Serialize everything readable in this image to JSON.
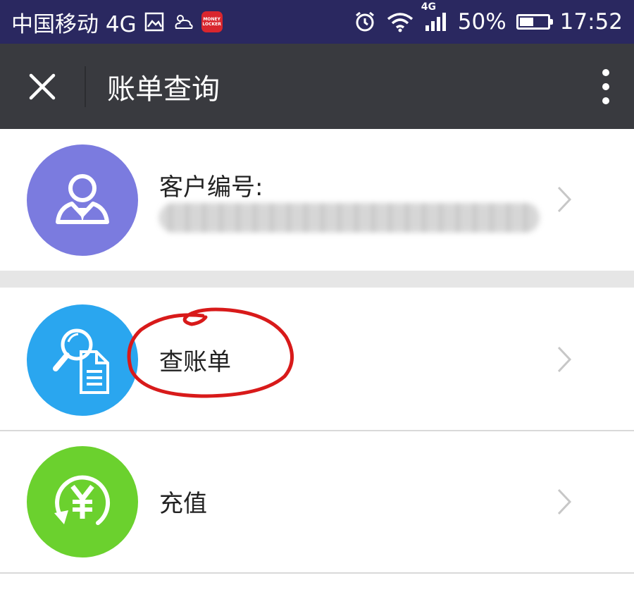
{
  "status_bar": {
    "carrier": "中国移动 4G",
    "app_badge": "MONEY LOCKER",
    "network_badge": "4G",
    "battery_percent": "50%",
    "battery_level": 0.5,
    "time": "17:52",
    "icons": [
      "gallery-icon",
      "weather-icon",
      "money-locker-icon",
      "alarm-icon",
      "wifi-icon",
      "signal-icon",
      "battery-icon"
    ]
  },
  "header": {
    "title": "账单查询",
    "close_icon": "close-icon",
    "more_icon": "more-vertical-icon"
  },
  "customer": {
    "label": "客户编号:",
    "number_blurred": true,
    "icon": "user-icon",
    "icon_color": "#7b7bdf"
  },
  "menu": {
    "items": [
      {
        "label": "查账单",
        "icon": "search-bill-icon",
        "icon_color": "#2aa6ef"
      },
      {
        "label": "充值",
        "icon": "yuan-recharge-icon",
        "icon_color": "#6bd12e"
      }
    ]
  },
  "colors": {
    "status_bar_bg": "#2a2860",
    "title_bar_bg": "#393a3f",
    "annotation": "#d81a1a"
  }
}
